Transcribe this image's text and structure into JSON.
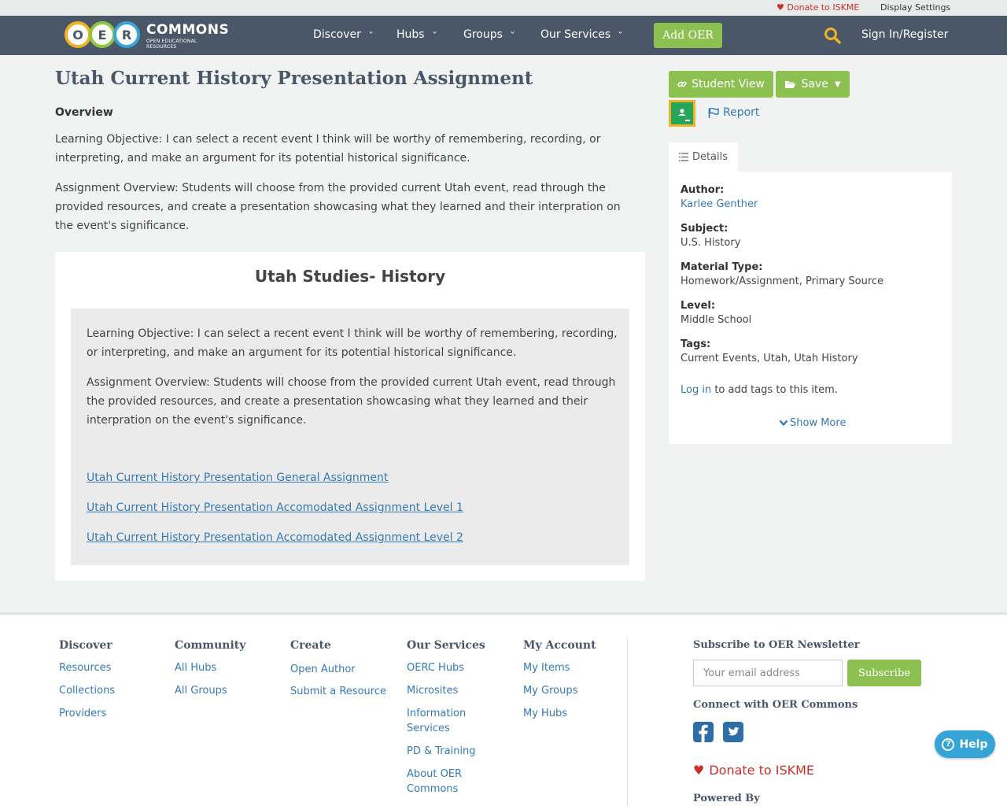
{
  "utility_bar": {
    "donate": "Donate to ISKME",
    "display_settings": "Display Settings"
  },
  "nav": {
    "logo": {
      "letters": [
        "O",
        "E",
        "R"
      ],
      "wordmark": "COMMONS",
      "tagline": "OPEN EDUCATIONAL RESOURCES"
    },
    "items": [
      "Discover",
      "Hubs",
      "Groups",
      "Our Services"
    ],
    "add_oer": "Add OER",
    "sign_in": "Sign In/Register",
    "search_icon": "search-icon"
  },
  "main": {
    "title": "Utah Current History Presentation Assignment",
    "overview_heading": "Overview",
    "overview_paragraphs": [
      "Learning Objective: I can select a recent event I think will be worthy of remembering, recording, or interpreting, and make an argument for its potential historical significance.",
      "Assignment Overview: Students will choose from the provided current Utah event, read through the provided resources, and create a presentation showcasing what they learned and their interpration on the event's significance."
    ],
    "card": {
      "title": "Utah Studies- History",
      "paragraphs": [
        "Learning Objective: I can select a recent event I think will be worthy of remembering, recording, or interpreting, and make an argument for its potential historical significance.",
        "Assignment Overview: Students will choose from the provided current Utah event, read through the provided resources, and create a presentation showcasing what they learned and their interpration on the event's significance."
      ],
      "links": [
        "Utah Current History Presentation General Assignment",
        "Utah Current History Presentation Accomodated Assignment Level 1",
        "Utah Current History Presentation Accomodated Assignment Level 2"
      ]
    }
  },
  "sidebar": {
    "student_view": "Student View",
    "save": "Save",
    "report": "Report",
    "details_tab": "Details",
    "details": {
      "author_label": "Author:",
      "author": "Karlee Genther",
      "subject_label": "Subject:",
      "subject": "U.S. History",
      "material_label": "Material Type:",
      "material": "Homework/Assignment, Primary Source",
      "level_label": "Level:",
      "level": "Middle School",
      "tags_label": "Tags:",
      "tags": "Current Events, Utah, Utah History",
      "login_link": "Log in",
      "login_suffix": " to add tags to this item.",
      "show_more": "Show More"
    }
  },
  "footer": {
    "columns": [
      {
        "heading": "Discover",
        "links": [
          "Resources",
          "Collections",
          "Providers"
        ]
      },
      {
        "heading": "Community",
        "links": [
          "All Hubs",
          "All Groups"
        ]
      },
      {
        "heading": "Create",
        "links": [
          "Open Author",
          "Submit a Resource"
        ]
      },
      {
        "heading": "Our Services",
        "links": [
          "OERC Hubs",
          "Microsites",
          "Information Services",
          "PD & Training",
          "About OER Commons"
        ]
      },
      {
        "heading": "My Account",
        "links": [
          "My Items",
          "My Groups",
          "My Hubs"
        ]
      }
    ],
    "newsletter_heading": "Subscribe to OER Newsletter",
    "email_placeholder": "Your email address",
    "subscribe": "Subscribe",
    "connect_heading": "Connect with OER Commons",
    "donate": "Donate to ISKME",
    "powered_by": "Powered By"
  },
  "help": {
    "label": "Help"
  },
  "colors": {
    "nav_bg": "#4a5768",
    "accent_green": "#8cc152",
    "link": "#337ab7",
    "donate_red": "#c9302c",
    "logo_o": "#f0b323",
    "logo_e": "#8ec63f",
    "logo_r": "#35a5d8"
  }
}
